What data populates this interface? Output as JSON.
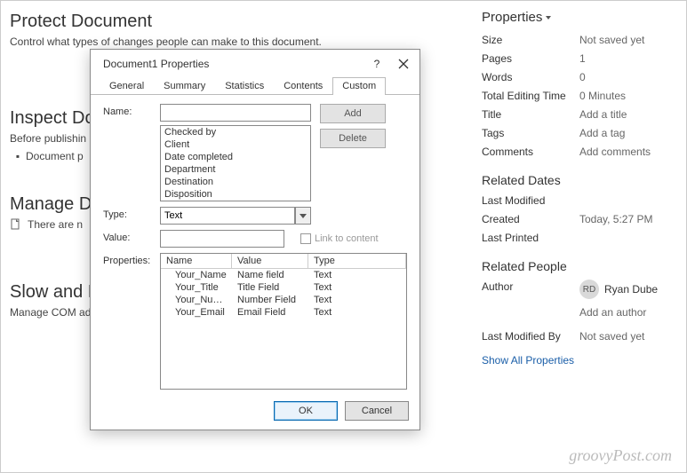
{
  "left": {
    "protect_title": "Protect Document",
    "protect_sub": "Control what types of changes people can make to this document.",
    "inspect_title": "Inspect Do",
    "inspect_sub": "Before publishin",
    "inspect_bullet": "Document p",
    "manage_title": "Manage D",
    "manage_sub": "There are n",
    "slow_title": "Slow and D",
    "slow_sub": "Manage COM ad"
  },
  "dialog": {
    "title": "Document1 Properties",
    "help": "?",
    "tabs": [
      "General",
      "Summary",
      "Statistics",
      "Contents",
      "Custom"
    ],
    "active_tab": 4,
    "labels": {
      "name": "Name:",
      "type": "Type:",
      "value": "Value:",
      "properties": "Properties:",
      "link": "Link to content"
    },
    "name_list": [
      "Checked by",
      "Client",
      "Date completed",
      "Department",
      "Destination",
      "Disposition"
    ],
    "type_value": "Text",
    "btn_add": "Add",
    "btn_delete": "Delete",
    "table": {
      "headers": [
        "Name",
        "Value",
        "Type"
      ],
      "rows": [
        {
          "n": "Your_Name",
          "v": "Name field",
          "t": "Text"
        },
        {
          "n": "Your_Title",
          "v": "Title Field",
          "t": "Text"
        },
        {
          "n": "Your_Nu…",
          "v": "Number Field",
          "t": "Text"
        },
        {
          "n": "Your_Email",
          "v": "Email Field",
          "t": "Text"
        }
      ]
    },
    "btn_ok": "OK",
    "btn_cancel": "Cancel"
  },
  "props": {
    "title": "Properties",
    "rows": [
      {
        "k": "Size",
        "v": "Not saved yet"
      },
      {
        "k": "Pages",
        "v": "1"
      },
      {
        "k": "Words",
        "v": "0"
      },
      {
        "k": "Total Editing Time",
        "v": "0 Minutes"
      },
      {
        "k": "Title",
        "v": "Add a title"
      },
      {
        "k": "Tags",
        "v": "Add a tag"
      },
      {
        "k": "Comments",
        "v": "Add comments"
      }
    ],
    "dates_title": "Related Dates",
    "dates": [
      {
        "k": "Last Modified",
        "v": ""
      },
      {
        "k": "Created",
        "v": "Today, 5:27 PM"
      },
      {
        "k": "Last Printed",
        "v": ""
      }
    ],
    "people_title": "Related People",
    "author_label": "Author",
    "author_initials": "RD",
    "author_name": "Ryan Dube",
    "add_author": "Add an author",
    "lastmod_label": "Last Modified By",
    "lastmod_value": "Not saved yet",
    "show_all": "Show All Properties"
  },
  "watermark": "groovyPost.com"
}
